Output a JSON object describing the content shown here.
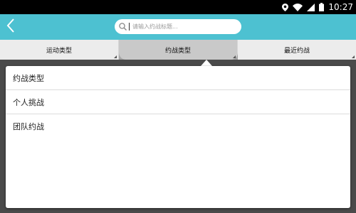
{
  "status_bar": {
    "time": "10:27",
    "icons": [
      "location-icon",
      "wifi-icon",
      "signal-icon",
      "battery-icon"
    ]
  },
  "header": {
    "back_icon": "chevron-left-icon",
    "search": {
      "placeholder": "请输入约战标题...",
      "value": "",
      "icon": "search-icon"
    }
  },
  "tabs": [
    {
      "label": "运动类型",
      "active": false
    },
    {
      "label": "约战类型",
      "active": true
    },
    {
      "label": "最近约战",
      "active": false
    }
  ],
  "dropdown": {
    "options": [
      {
        "label": "约战类型"
      },
      {
        "label": "个人挑战"
      },
      {
        "label": "团队约战"
      }
    ]
  },
  "colors": {
    "header": "#4dc1d1",
    "status_bar": "#000000",
    "overlay": "#4a4a4a"
  }
}
